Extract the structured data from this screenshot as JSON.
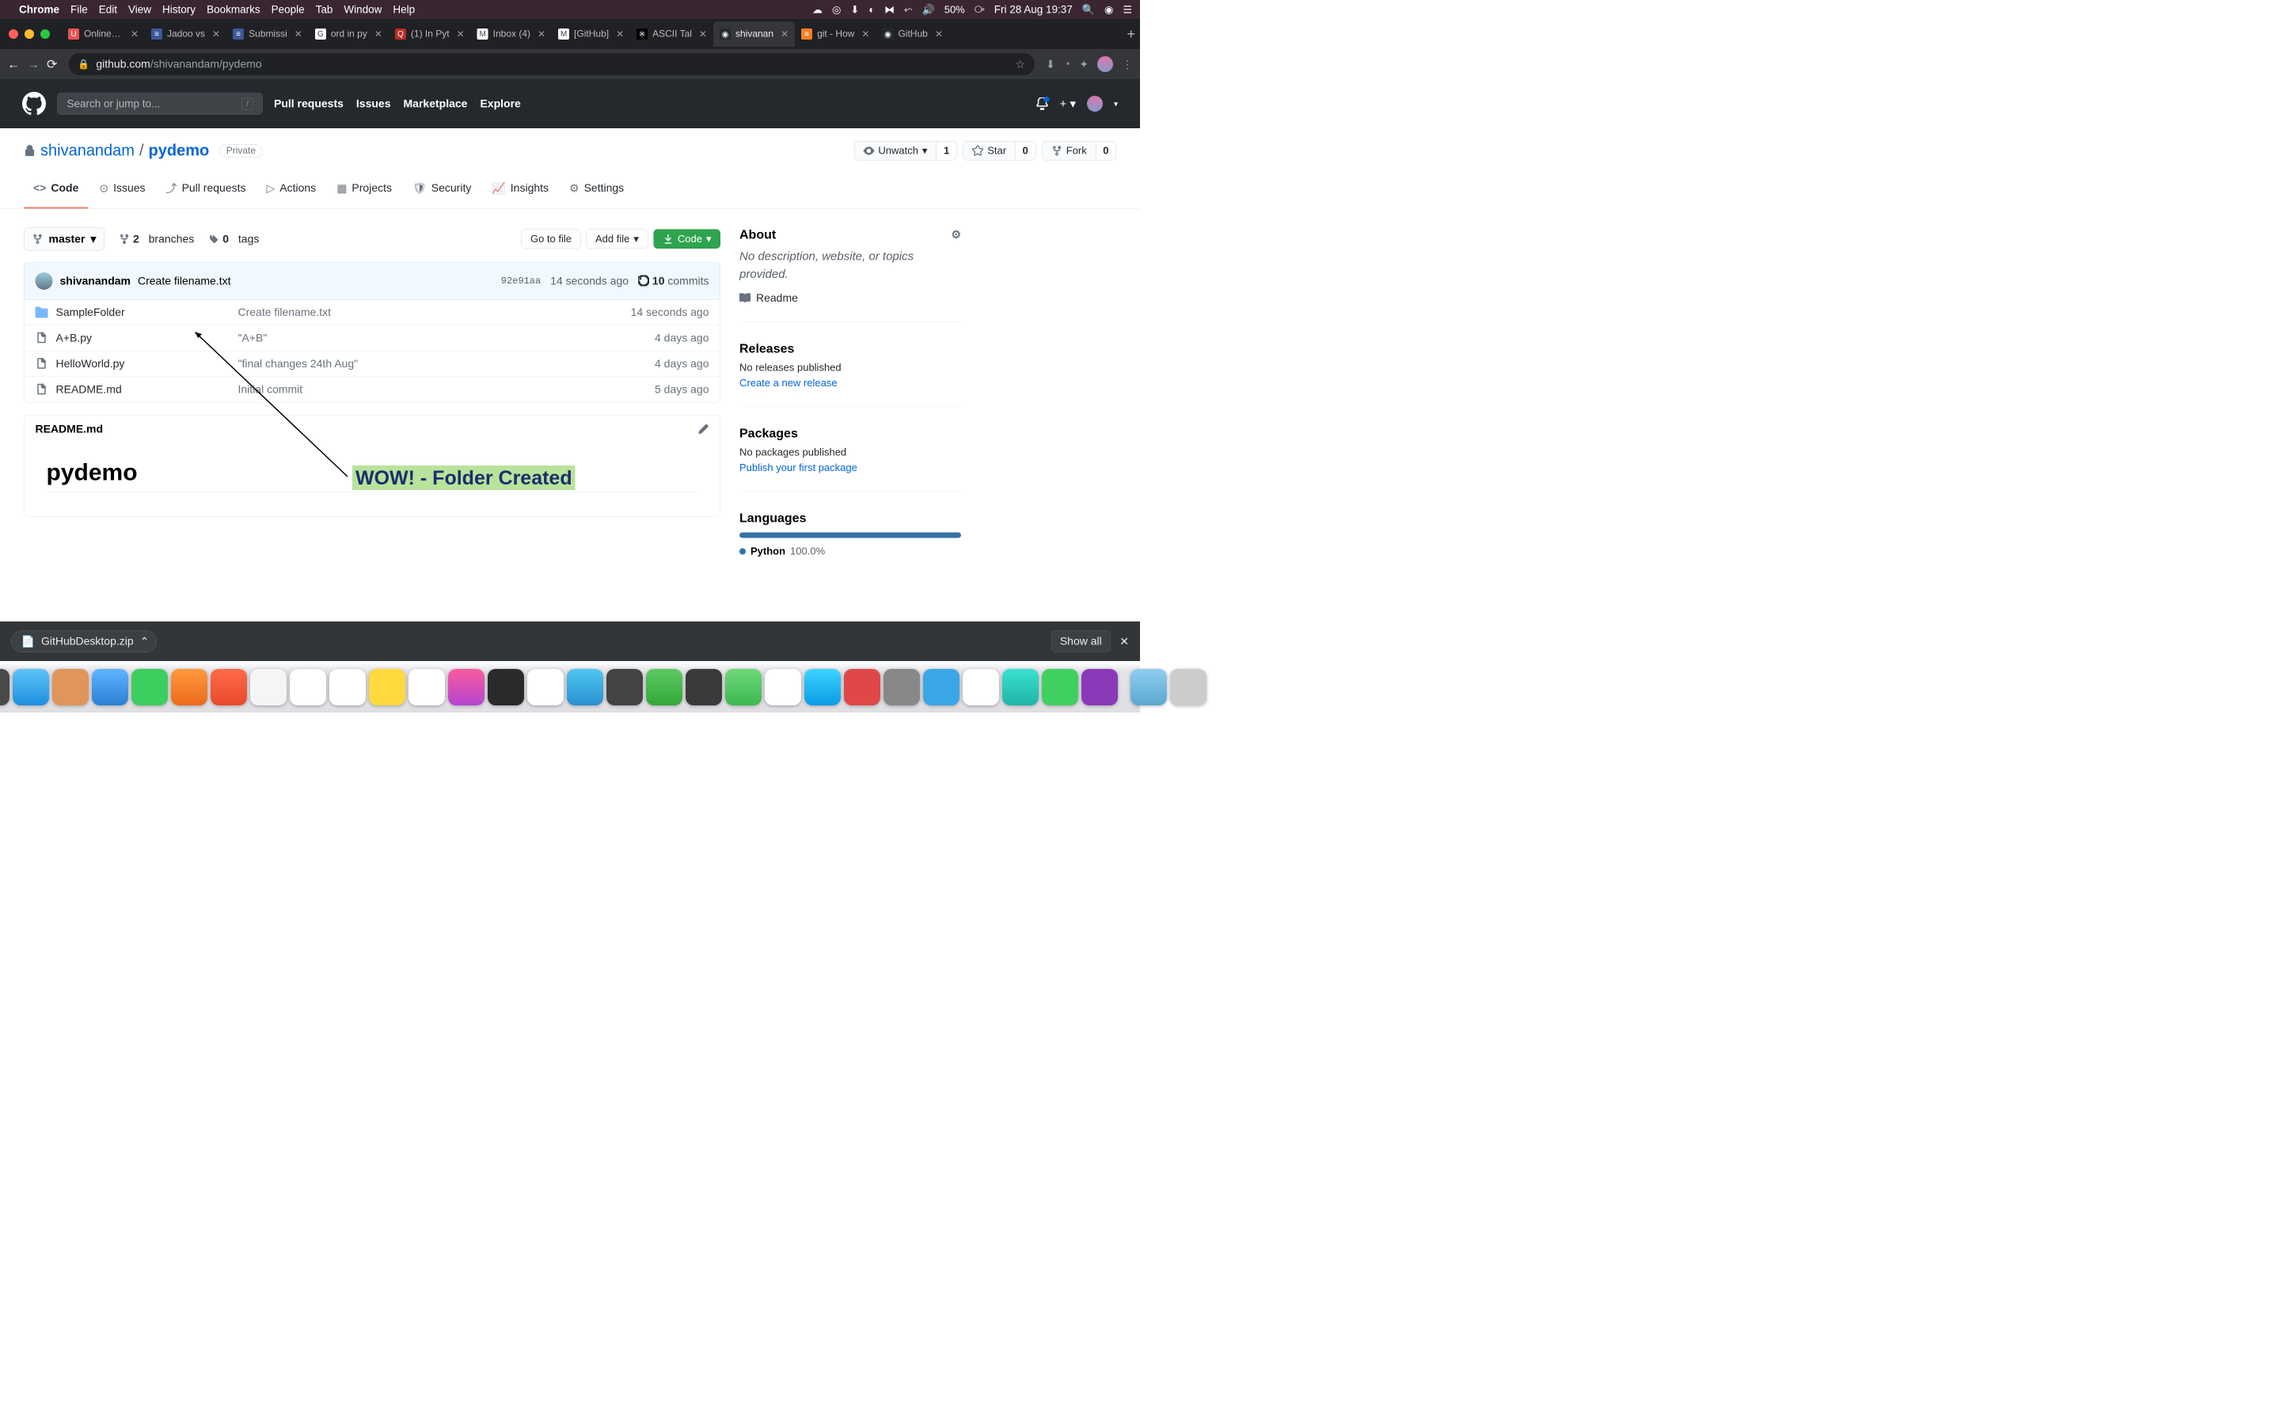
{
  "menubar": {
    "app": "Chrome",
    "items": [
      "File",
      "Edit",
      "View",
      "History",
      "Bookmarks",
      "People",
      "Tab",
      "Window",
      "Help"
    ],
    "battery": "50%",
    "clock": "Fri 28 Aug  19:37"
  },
  "tabs": [
    {
      "title": "Online Co",
      "fav": "U",
      "favbg": "#ec5252"
    },
    {
      "title": "Jadoo vs",
      "fav": "≡",
      "favbg": "#3b5998"
    },
    {
      "title": "Submissi",
      "fav": "≡",
      "favbg": "#3b5998"
    },
    {
      "title": "ord in py",
      "fav": "G",
      "favbg": "#fff"
    },
    {
      "title": "(1) In Pyt",
      "fav": "Q",
      "favbg": "#b92b27"
    },
    {
      "title": "Inbox (4)",
      "fav": "M",
      "favbg": "#fff"
    },
    {
      "title": "[GitHub]",
      "fav": "M",
      "favbg": "#fff"
    },
    {
      "title": "ASCII Tal",
      "fav": "※",
      "favbg": "#000"
    },
    {
      "title": "shivanan",
      "fav": "◉",
      "favbg": "#24292e",
      "active": true
    },
    {
      "title": "git - How",
      "fav": "≡",
      "favbg": "#f48024"
    },
    {
      "title": "GitHub",
      "fav": "◉",
      "favbg": "#24292e"
    }
  ],
  "url": {
    "host": "github.com",
    "path": "/shivanandam/pydemo"
  },
  "gh": {
    "search_placeholder": "Search or jump to...",
    "nav": [
      "Pull requests",
      "Issues",
      "Marketplace",
      "Explore"
    ]
  },
  "repo": {
    "owner": "shivanandam",
    "name": "pydemo",
    "visibility": "Private",
    "watch": {
      "label": "Unwatch",
      "count": "1"
    },
    "star": {
      "label": "Star",
      "count": "0"
    },
    "fork": {
      "label": "Fork",
      "count": "0"
    },
    "tabs": [
      {
        "icon": "<>",
        "label": "Code",
        "active": true
      },
      {
        "icon": "⊙",
        "label": "Issues"
      },
      {
        "icon": "⤴",
        "label": "Pull requests"
      },
      {
        "icon": "▷",
        "label": "Actions"
      },
      {
        "icon": "▦",
        "label": "Projects"
      },
      {
        "icon": "🛡",
        "label": "Security"
      },
      {
        "icon": "📈",
        "label": "Insights"
      },
      {
        "icon": "⚙",
        "label": "Settings"
      }
    ],
    "branch": "master",
    "branches": {
      "count": "2",
      "label": "branches"
    },
    "tags": {
      "count": "0",
      "label": "tags"
    },
    "go_to_file": "Go to file",
    "add_file": "Add file",
    "code_btn": "Code",
    "commit": {
      "author": "shivanandam",
      "message": "Create filename.txt",
      "sha": "92e91aa",
      "time": "14 seconds ago",
      "commits_count": "10",
      "commits_label": "commits"
    },
    "files": [
      {
        "type": "folder",
        "name": "SampleFolder",
        "msg": "Create filename.txt",
        "time": "14 seconds ago"
      },
      {
        "type": "file",
        "name": "A+B.py",
        "msg": "\"A+B\"",
        "time": "4 days ago"
      },
      {
        "type": "file",
        "name": "HelloWorld.py",
        "msg": "\"final changes 24th Aug\"",
        "time": "4 days ago"
      },
      {
        "type": "file",
        "name": "README.md",
        "msg": "Initial commit",
        "time": "5 days ago"
      }
    ],
    "readme": {
      "filename": "README.md",
      "title": "pydemo"
    }
  },
  "sidebar": {
    "about": {
      "title": "About",
      "desc": "No description, website, or topics provided.",
      "readme": "Readme"
    },
    "releases": {
      "title": "Releases",
      "empty": "No releases published",
      "action": "Create a new release"
    },
    "packages": {
      "title": "Packages",
      "empty": "No packages published",
      "action": "Publish your first package"
    },
    "languages": {
      "title": "Languages",
      "name": "Python",
      "pct": "100.0%"
    }
  },
  "annotation": "WOW! - Folder Created",
  "download": {
    "file": "GitHubDesktop.zip",
    "showall": "Show all"
  }
}
